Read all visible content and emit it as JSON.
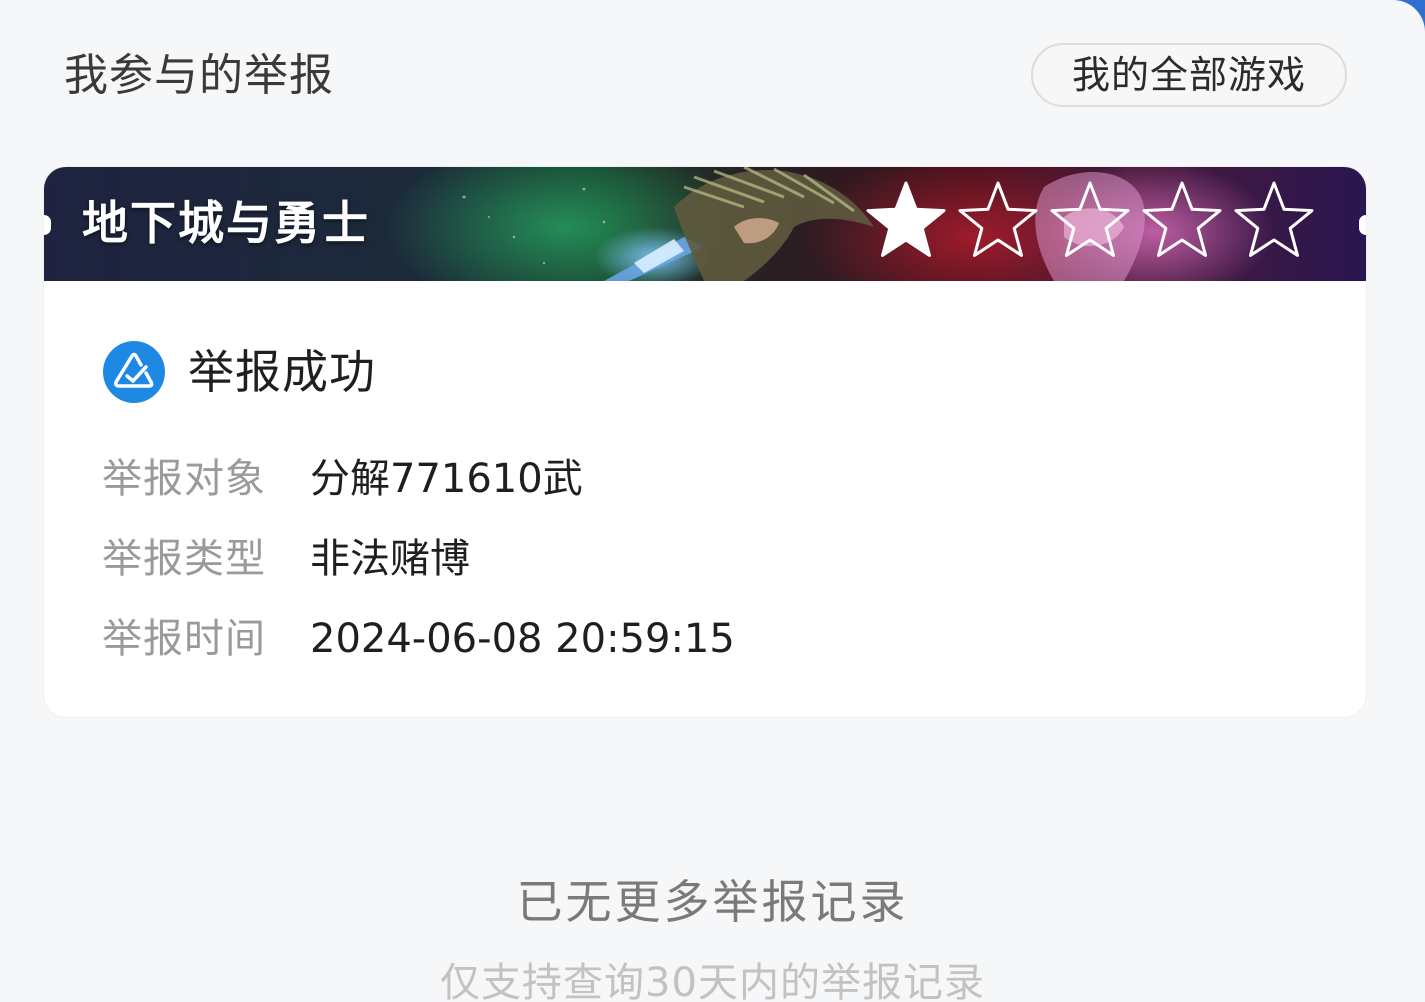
{
  "header": {
    "title": "我参与的举报",
    "all_games_label": "我的全部游戏"
  },
  "card": {
    "game_name": "地下城与勇士",
    "rating": {
      "filled": 1,
      "total": 5
    },
    "status_icon": "report-shield-icon",
    "status": "举报成功",
    "fields": {
      "target_label": "举报对象",
      "target_value": "分解771610武",
      "type_label": "举报类型",
      "type_value": "非法赌博",
      "time_label": "举报时间",
      "time_value": "2024-06-08 20:59:15"
    }
  },
  "footer": {
    "main": "已无更多举报记录",
    "sub": "仅支持查询30天内的举报记录"
  },
  "colors": {
    "accent": "#1e88e5",
    "background": "#f6f7f9",
    "card": "#ffffff",
    "label": "#9a9a9a",
    "text": "#1f1f1f"
  }
}
